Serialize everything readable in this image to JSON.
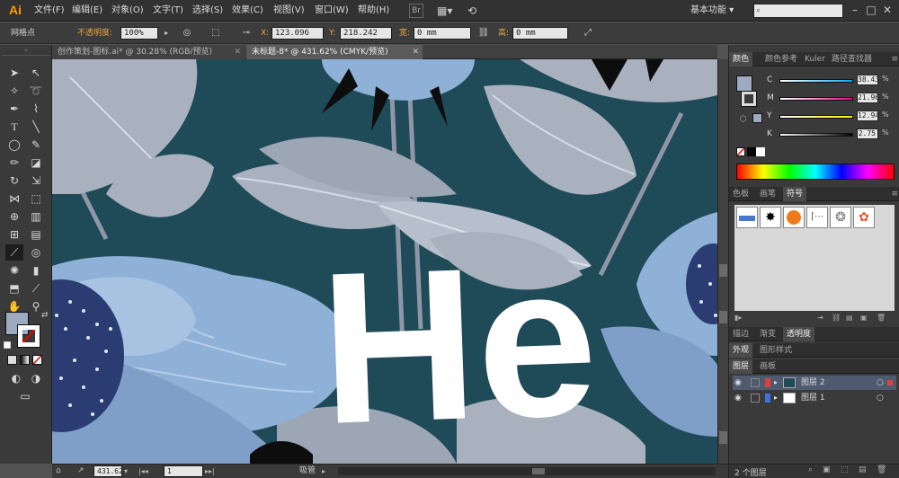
{
  "app": {
    "logo": "Ai"
  },
  "menu": [
    {
      "label": "文件(F)"
    },
    {
      "label": "编辑(E)"
    },
    {
      "label": "对象(O)"
    },
    {
      "label": "文字(T)"
    },
    {
      "label": "选择(S)"
    },
    {
      "label": "效果(C)"
    },
    {
      "label": "视图(V)"
    },
    {
      "label": "窗口(W)"
    },
    {
      "label": "帮助(H)"
    }
  ],
  "workspace": {
    "label": "基本功能"
  },
  "control": {
    "mode_label": "网格点",
    "opacity_label": "不透明度:",
    "opacity_value": "100%",
    "x_label": "X:",
    "x_value": "123.096",
    "y_label": "Y:",
    "y_value": "218.242",
    "w_label": "宽:",
    "w_value": "0 mm",
    "h_label": "高:",
    "h_value": "0 mm"
  },
  "tabs": [
    {
      "label": "创作策划-图标.ai* @ 30.28% (RGB/预览)"
    },
    {
      "label": "未标题-8* @ 431.62% (CMYK/预览)"
    }
  ],
  "canvas": {
    "headline": "He"
  },
  "status": {
    "zoom": "431.62",
    "page": "1",
    "tool": "吸管"
  },
  "color_panel": {
    "tabs": [
      "颜色",
      "颜色参考",
      "Kuler",
      "路径查找器"
    ],
    "channels": [
      {
        "letter": "C",
        "value": "38.43"
      },
      {
        "letter": "M",
        "value": "21.96"
      },
      {
        "letter": "Y",
        "value": "12.94"
      },
      {
        "letter": "K",
        "value": "2.75"
      }
    ],
    "percent": "%"
  },
  "symbols_panel": {
    "tabs": [
      "色板",
      "画笔",
      "符号"
    ]
  },
  "transparency_panel": {
    "tabs": [
      "描边",
      "渐变",
      "透明度"
    ]
  },
  "appearance_panel": {
    "tabs": [
      "外观",
      "图形样式"
    ]
  },
  "layers_panel": {
    "tabs": [
      "图层",
      "画板"
    ],
    "layers": [
      {
        "name": "图层 2"
      },
      {
        "name": "图层 1"
      }
    ],
    "count": "2 个图层"
  },
  "colors": {
    "bg_teal": "#1f4a57",
    "leaf_gray": "#a9b1bf",
    "petal_blue": "#8fb1d8",
    "dark_navy": "#2a3c72",
    "text_white": "#ffffff"
  }
}
